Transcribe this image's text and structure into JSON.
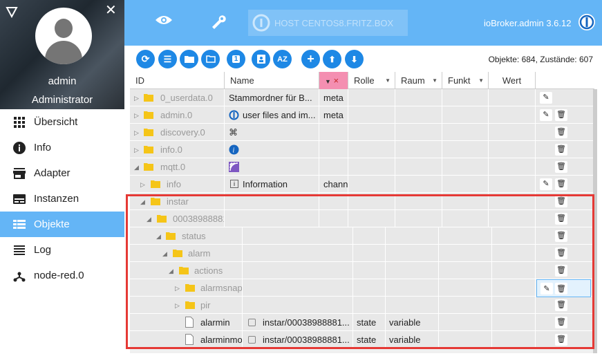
{
  "sidebar": {
    "user_name": "admin",
    "user_role": "Administrator",
    "items": [
      {
        "label": "Übersicht",
        "icon": "grid-icon",
        "active": false
      },
      {
        "label": "Info",
        "icon": "info-icon",
        "active": false
      },
      {
        "label": "Adapter",
        "icon": "store-icon",
        "active": false
      },
      {
        "label": "Instanzen",
        "icon": "instances-icon",
        "active": false
      },
      {
        "label": "Objekte",
        "icon": "list-icon",
        "active": true
      },
      {
        "label": "Log",
        "icon": "log-icon",
        "active": false
      },
      {
        "label": "node-red.0",
        "icon": "node-icon",
        "active": false
      }
    ]
  },
  "topbar": {
    "host_label": "HOST CENTOS8.FRITZ.BOX",
    "version": "ioBroker.admin 3.6.12"
  },
  "toolbar": {
    "object_count": "Objekte: 684, Zustände: 607",
    "counter_badge": "1",
    "sort_badge": "AZ"
  },
  "grid": {
    "columns": [
      "ID",
      "Name",
      "",
      "Rolle",
      "Raum",
      "Funkt",
      "Wert"
    ],
    "filter_clear": "×",
    "rows": [
      {
        "id": "0_userdata.0",
        "name": "Stammordner für B...",
        "type": "meta",
        "role": "",
        "value": ""
      },
      {
        "id": "admin.0",
        "name": "user files and im...",
        "type": "meta",
        "role": "",
        "value": ""
      },
      {
        "id": "discovery.0",
        "name": "",
        "type": "",
        "role": "",
        "value": ""
      },
      {
        "id": "info.0",
        "name": "",
        "type": "",
        "role": "",
        "value": ""
      },
      {
        "id": "mqtt.0",
        "name": "",
        "type": "",
        "role": "",
        "value": ""
      },
      {
        "id": "info",
        "name": "Information",
        "type": "chann",
        "role": "",
        "value": ""
      },
      {
        "id": "instar",
        "name": "",
        "type": "",
        "role": "",
        "value": ""
      },
      {
        "id": "00038988881",
        "name": "",
        "type": "",
        "role": "",
        "value": ""
      },
      {
        "id": "status",
        "name": "",
        "type": "",
        "role": "",
        "value": ""
      },
      {
        "id": "alarm",
        "name": "",
        "type": "",
        "role": "",
        "value": ""
      },
      {
        "id": "actions",
        "name": "",
        "type": "",
        "role": "",
        "value": ""
      },
      {
        "id": "alarmsnap",
        "name": "",
        "type": "",
        "role": "",
        "value": ""
      },
      {
        "id": "pir",
        "name": "",
        "type": "",
        "role": "",
        "value": ""
      },
      {
        "id": "alarmin",
        "name": "instar/00038988881...",
        "type": "state",
        "role": "variable",
        "value": ""
      },
      {
        "id": "alarminmo",
        "name": "instar/00038988881...",
        "type": "state",
        "role": "variable",
        "value": ""
      }
    ]
  },
  "colors": {
    "accent": "#64b5f6",
    "button": "#1e88e5",
    "highlight": "#e53935",
    "folder": "#f5c518"
  }
}
